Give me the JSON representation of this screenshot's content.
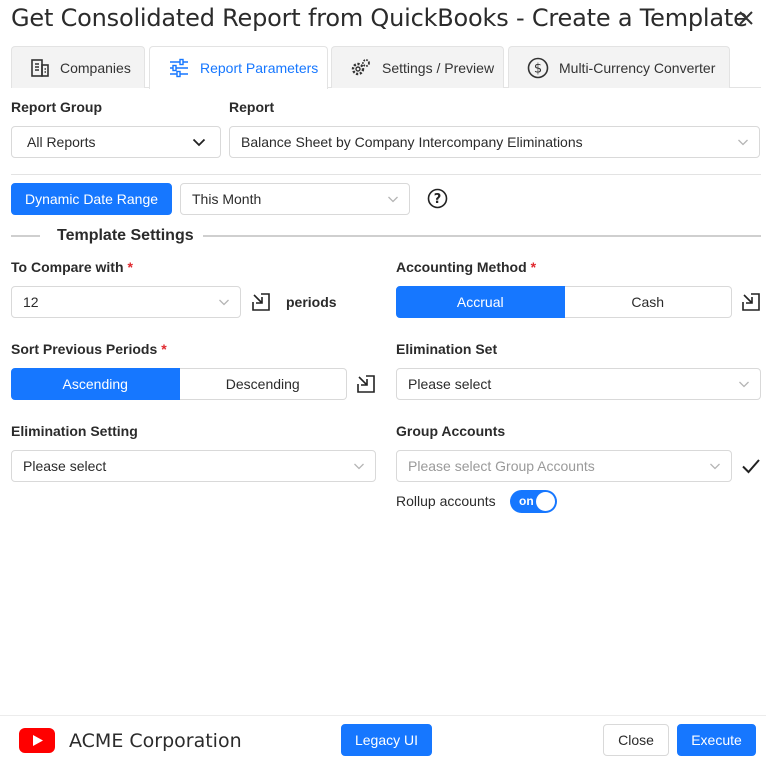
{
  "window": {
    "title": "Get Consolidated Report from QuickBooks - Create a Template"
  },
  "tabs": [
    {
      "label": "Companies",
      "icon": "building-icon"
    },
    {
      "label": "Report Parameters",
      "icon": "sliders-icon"
    },
    {
      "label": "Settings / Preview",
      "icon": "gears-icon"
    },
    {
      "label": "Multi-Currency Converter",
      "icon": "dollar-circle-icon"
    }
  ],
  "active_tab": "Report Parameters",
  "report_group": {
    "label": "Report Group",
    "value": "All Reports"
  },
  "report": {
    "label": "Report",
    "value": "Balance Sheet by Company Intercompany Eliminations"
  },
  "date_range": {
    "button_label": "Dynamic Date Range",
    "value": "This Month"
  },
  "template_settings": {
    "title": "Template Settings"
  },
  "compare": {
    "label": "To Compare with",
    "value": "12",
    "unit": "periods"
  },
  "accounting_method": {
    "label": "Accounting Method",
    "options": [
      "Accrual",
      "Cash"
    ],
    "selected": "Accrual"
  },
  "sort_periods": {
    "label": "Sort Previous Periods",
    "options": [
      "Ascending",
      "Descending"
    ],
    "selected": "Ascending"
  },
  "elimination_set": {
    "label": "Elimination Set",
    "placeholder": "Please select"
  },
  "elimination_setting": {
    "label": "Elimination Setting",
    "placeholder": "Please select"
  },
  "group_accounts": {
    "label": "Group Accounts",
    "placeholder": "Please select Group Accounts"
  },
  "rollup": {
    "label": "Rollup accounts",
    "state": "on"
  },
  "footer": {
    "company": "ACME Corporation",
    "legacy_label": "Legacy UI",
    "close_label": "Close",
    "execute_label": "Execute"
  },
  "colors": {
    "accent": "#1677ff",
    "required": "#e0282e",
    "youtube": "#ff0000"
  }
}
